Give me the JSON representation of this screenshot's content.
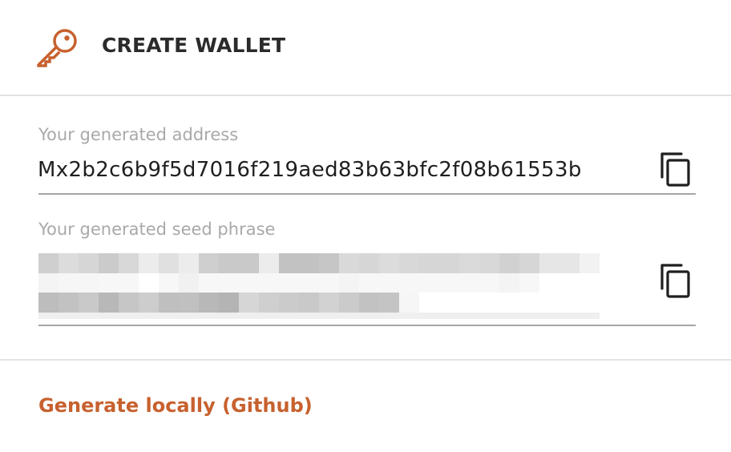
{
  "header": {
    "title": "CREATE WALLET",
    "icon": "key-icon",
    "accent_color": "#c7612e"
  },
  "address": {
    "label": "Your generated address",
    "value": "Mx2b2c6b9f5d7016f219aed83b63bfc2f08b61553b",
    "copy_icon": "copy-icon"
  },
  "seed": {
    "label": "Your generated seed phrase",
    "value_state": "blurred",
    "copy_icon": "copy-icon"
  },
  "footer": {
    "link_label": "Generate locally (Github)",
    "link_color": "#c7612e"
  }
}
